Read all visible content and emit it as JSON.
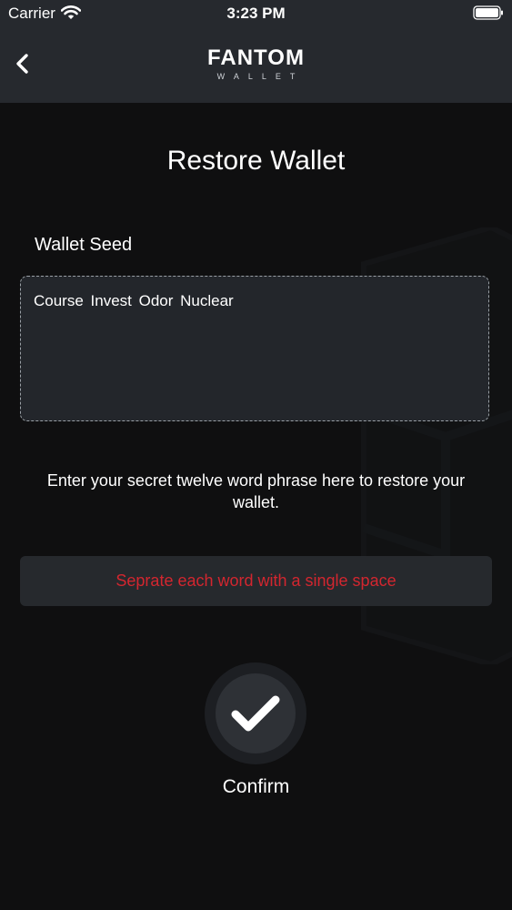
{
  "status_bar": {
    "carrier": "Carrier",
    "time": "3:23 PM",
    "wifi_icon": "wifi-icon",
    "battery_icon": "battery-icon"
  },
  "header": {
    "back_icon": "chevron-left-icon",
    "logo_main": "FANTOM",
    "logo_sub": "WALLET"
  },
  "main": {
    "title": "Restore Wallet",
    "seed_label": "Wallet Seed",
    "seed_value": "Course Invest Odor Nuclear",
    "instructions": "Enter your secret twelve word phrase here to restore your wallet.",
    "warning": "Seprate each word with a single space",
    "confirm_icon": "checkmark-icon",
    "confirm_label": "Confirm"
  },
  "colors": {
    "header_bg": "#26292e",
    "page_bg": "#0f0f10",
    "warning_text": "#d3262f",
    "field_bg": "#23262b"
  }
}
